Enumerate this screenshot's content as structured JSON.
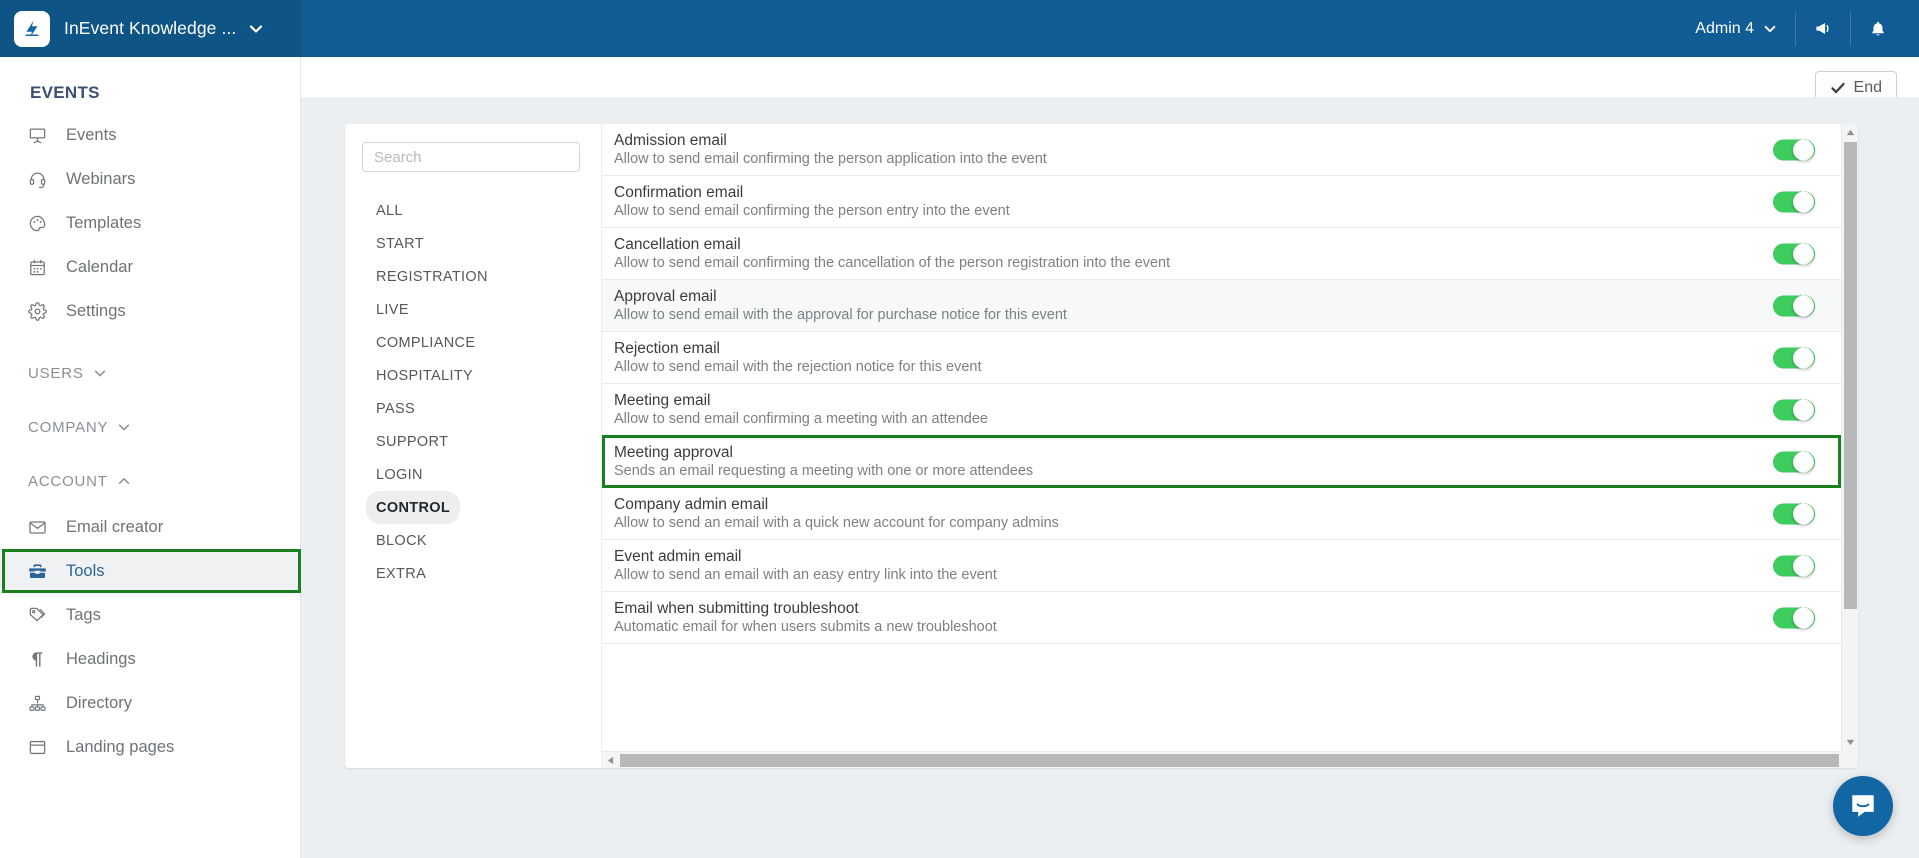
{
  "topbar": {
    "logo_icon": "inevent-logo-icon",
    "org_name": "InEvent Knowledge ...",
    "org_caret_icon": "chevron-down-icon",
    "admin_label": "Admin 4",
    "admin_caret_icon": "chevron-down-icon",
    "announcement_icon": "megaphone-icon",
    "notification_icon": "bell-icon",
    "background_color": "#115c94"
  },
  "subheader": {
    "end_label": "End",
    "end_check_icon": "check-icon"
  },
  "sidebar": {
    "title": "EVENTS",
    "items": [
      {
        "label": "Events",
        "icon": "presentation-screen-icon"
      },
      {
        "label": "Webinars",
        "icon": "headset-icon"
      },
      {
        "label": "Templates",
        "icon": "palette-icon"
      },
      {
        "label": "Calendar",
        "icon": "calendar-icon"
      },
      {
        "label": "Settings",
        "icon": "gear-icon"
      }
    ],
    "groups": [
      {
        "label": "USERS",
        "caret": "chevron-down-icon",
        "expanded": false
      },
      {
        "label": "COMPANY",
        "caret": "chevron-down-icon",
        "expanded": false
      },
      {
        "label": "ACCOUNT",
        "caret": "chevron-up-icon",
        "expanded": true
      }
    ],
    "account_items": [
      {
        "label": "Email creator",
        "icon": "envelope-icon",
        "selected": false
      },
      {
        "label": "Tools",
        "icon": "toolbox-icon",
        "selected": true
      },
      {
        "label": "Tags",
        "icon": "tags-icon",
        "selected": false
      },
      {
        "label": "Headings",
        "icon": "paragraph-icon",
        "selected": false
      },
      {
        "label": "Directory",
        "icon": "sitemap-icon",
        "selected": false
      },
      {
        "label": "Landing pages",
        "icon": "window-icon",
        "selected": false
      }
    ],
    "highlight_color": "#1a7f1f"
  },
  "filters": {
    "search_placeholder": "Search",
    "search_value": "",
    "categories": [
      {
        "label": "ALL",
        "active": false
      },
      {
        "label": "START",
        "active": false
      },
      {
        "label": "REGISTRATION",
        "active": false
      },
      {
        "label": "LIVE",
        "active": false
      },
      {
        "label": "COMPLIANCE",
        "active": false
      },
      {
        "label": "HOSPITALITY",
        "active": false
      },
      {
        "label": "PASS",
        "active": false
      },
      {
        "label": "SUPPORT",
        "active": false
      },
      {
        "label": "LOGIN",
        "active": false
      },
      {
        "label": "CONTROL",
        "active": true
      },
      {
        "label": "BLOCK",
        "active": false
      },
      {
        "label": "EXTRA",
        "active": false
      }
    ]
  },
  "tools_list": {
    "toggle_on_color": "#3ecc5f",
    "rows": [
      {
        "title": "Admission email",
        "description": "Allow to send email confirming the person application into the event",
        "toggle": "on",
        "hovered": false,
        "highlighted": false
      },
      {
        "title": "Confirmation email",
        "description": "Allow to send email confirming the person entry into the event",
        "toggle": "on",
        "hovered": false,
        "highlighted": false
      },
      {
        "title": "Cancellation email",
        "description": "Allow to send email confirming the cancellation of the person registration into the event",
        "toggle": "on",
        "hovered": false,
        "highlighted": false
      },
      {
        "title": "Approval email",
        "description": "Allow to send email with the approval for purchase notice for this event",
        "toggle": "on",
        "hovered": true,
        "highlighted": false
      },
      {
        "title": "Rejection email",
        "description": "Allow to send email with the rejection notice for this event",
        "toggle": "on",
        "hovered": false,
        "highlighted": false
      },
      {
        "title": "Meeting email",
        "description": "Allow to send email confirming a meeting with an attendee",
        "toggle": "on",
        "hovered": false,
        "highlighted": false
      },
      {
        "title": "Meeting approval",
        "description": "Sends an email requesting a meeting with one or more attendees",
        "toggle": "on",
        "hovered": false,
        "highlighted": true
      },
      {
        "title": "Company admin email",
        "description": "Allow to send an email with a quick new account for company admins",
        "toggle": "on",
        "hovered": false,
        "highlighted": false
      },
      {
        "title": "Event admin email",
        "description": "Allow to send an email with an easy entry link into the event",
        "toggle": "on",
        "hovered": false,
        "highlighted": false
      },
      {
        "title": "Email when submitting troubleshoot",
        "description": "Automatic email for when users submits a new troubleshoot",
        "toggle": "on",
        "hovered": false,
        "highlighted": false
      }
    ]
  },
  "scrollbars": {
    "vertical_up_icon": "caret-up-icon",
    "vertical_down_icon": "caret-down-icon",
    "horizontal_left_icon": "caret-left-icon"
  },
  "chat": {
    "icon": "intercom-chat-icon",
    "color": "#1266a3"
  }
}
